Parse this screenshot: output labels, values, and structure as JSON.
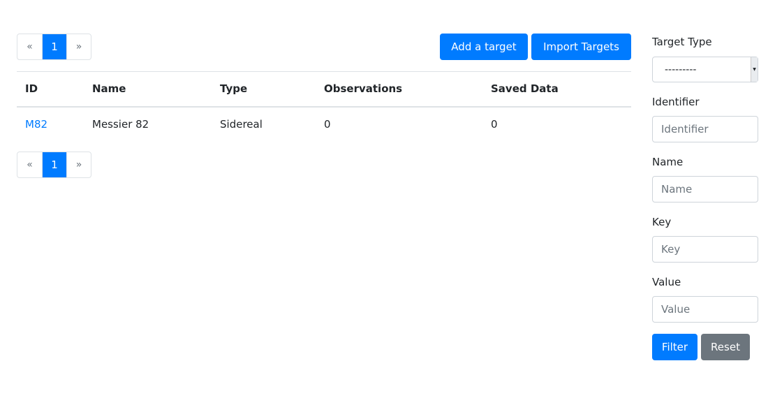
{
  "pagination": {
    "prev": "«",
    "current": "1",
    "next": "»"
  },
  "toolbar": {
    "add_label": "Add a target",
    "import_label": "Import Targets"
  },
  "table": {
    "headers": [
      "ID",
      "Name",
      "Type",
      "Observations",
      "Saved Data"
    ],
    "rows": [
      {
        "id": "M82",
        "name": "Messier 82",
        "type": "Sidereal",
        "observations": "0",
        "saved_data": "0"
      }
    ]
  },
  "filter": {
    "target_type_label": "Target Type",
    "target_type_value": "---------",
    "identifier_label": "Identifier",
    "identifier_placeholder": "Identifier",
    "name_label": "Name",
    "name_placeholder": "Name",
    "key_label": "Key",
    "key_placeholder": "Key",
    "value_label": "Value",
    "value_placeholder": "Value",
    "filter_label": "Filter",
    "reset_label": "Reset"
  },
  "colors": {
    "primary": "#007bff",
    "secondary": "#6c757d"
  }
}
